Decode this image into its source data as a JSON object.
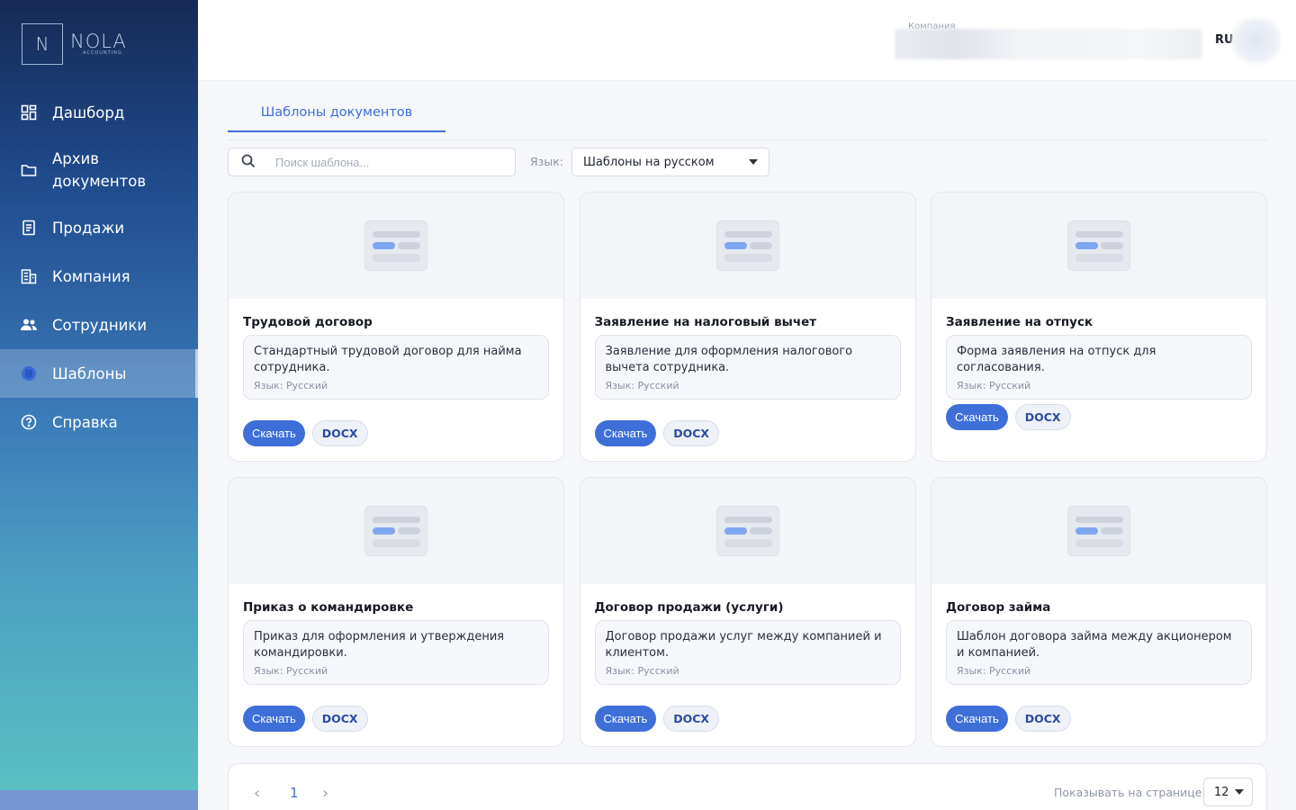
{
  "brand": {
    "logo_letter": "N",
    "name": "NOLA",
    "subtitle": "ACCOUNTING"
  },
  "sidebar": {
    "items": [
      {
        "label": "Дашборд",
        "icon": "dashboard-icon"
      },
      {
        "label": "Архив документов",
        "icon": "folder-icon"
      },
      {
        "label": "Продажи",
        "icon": "receipt-icon"
      },
      {
        "label": "Компания",
        "icon": "building-icon"
      },
      {
        "label": "Сотрудники",
        "icon": "people-icon"
      },
      {
        "label": "Шаблоны",
        "icon": "template-icon",
        "active": true
      },
      {
        "label": "Справка",
        "icon": "help-icon"
      }
    ]
  },
  "header": {
    "company_label": "Компания",
    "language": "RU"
  },
  "tabs": [
    {
      "label": "Шаблоны документов",
      "active": true
    }
  ],
  "filters": {
    "search_placeholder": "Поиск шаблона...",
    "language_label": "Язык:",
    "language_value": "Шаблоны на русском"
  },
  "cards": [
    {
      "title": "Трудовой договор",
      "description": "Стандартный трудовой договор для найма сотрудника.",
      "language": "Язык: Русский",
      "download": "Скачать",
      "format": "DOCX"
    },
    {
      "title": "Заявление на налоговый вычет",
      "description": "Заявление для оформления налогового вычета сотрудника.",
      "language": "Язык: Русский",
      "download": "Скачать",
      "format": "DOCX"
    },
    {
      "title": "Заявление на отпуск",
      "description": "Форма заявления на отпуск для согласования.",
      "language": "Язык: Русский",
      "download": "Скачать",
      "format": "DOCX"
    },
    {
      "title": "Приказ о командировке",
      "description": "Приказ для оформления и утверждения командировки.",
      "language": "Язык: Русский",
      "download": "Скачать",
      "format": "DOCX"
    },
    {
      "title": "Договор продажи (услуги)",
      "description": "Договор продажи услуг между компанией и клиентом.",
      "language": "Язык: Русский",
      "download": "Скачать",
      "format": "DOCX"
    },
    {
      "title": "Договор займа",
      "description": "Шаблон договора займа между акционером и компанией.",
      "language": "Язык: Русский",
      "download": "Скачать",
      "format": "DOCX"
    }
  ],
  "pagination": {
    "current_page": "1",
    "per_page_label": "Показывать на странице:",
    "per_page_value": "12"
  },
  "colors": {
    "accent": "#3e6fd9",
    "sidebar_top": "#162a55",
    "sidebar_bottom": "#5cc2c2"
  }
}
